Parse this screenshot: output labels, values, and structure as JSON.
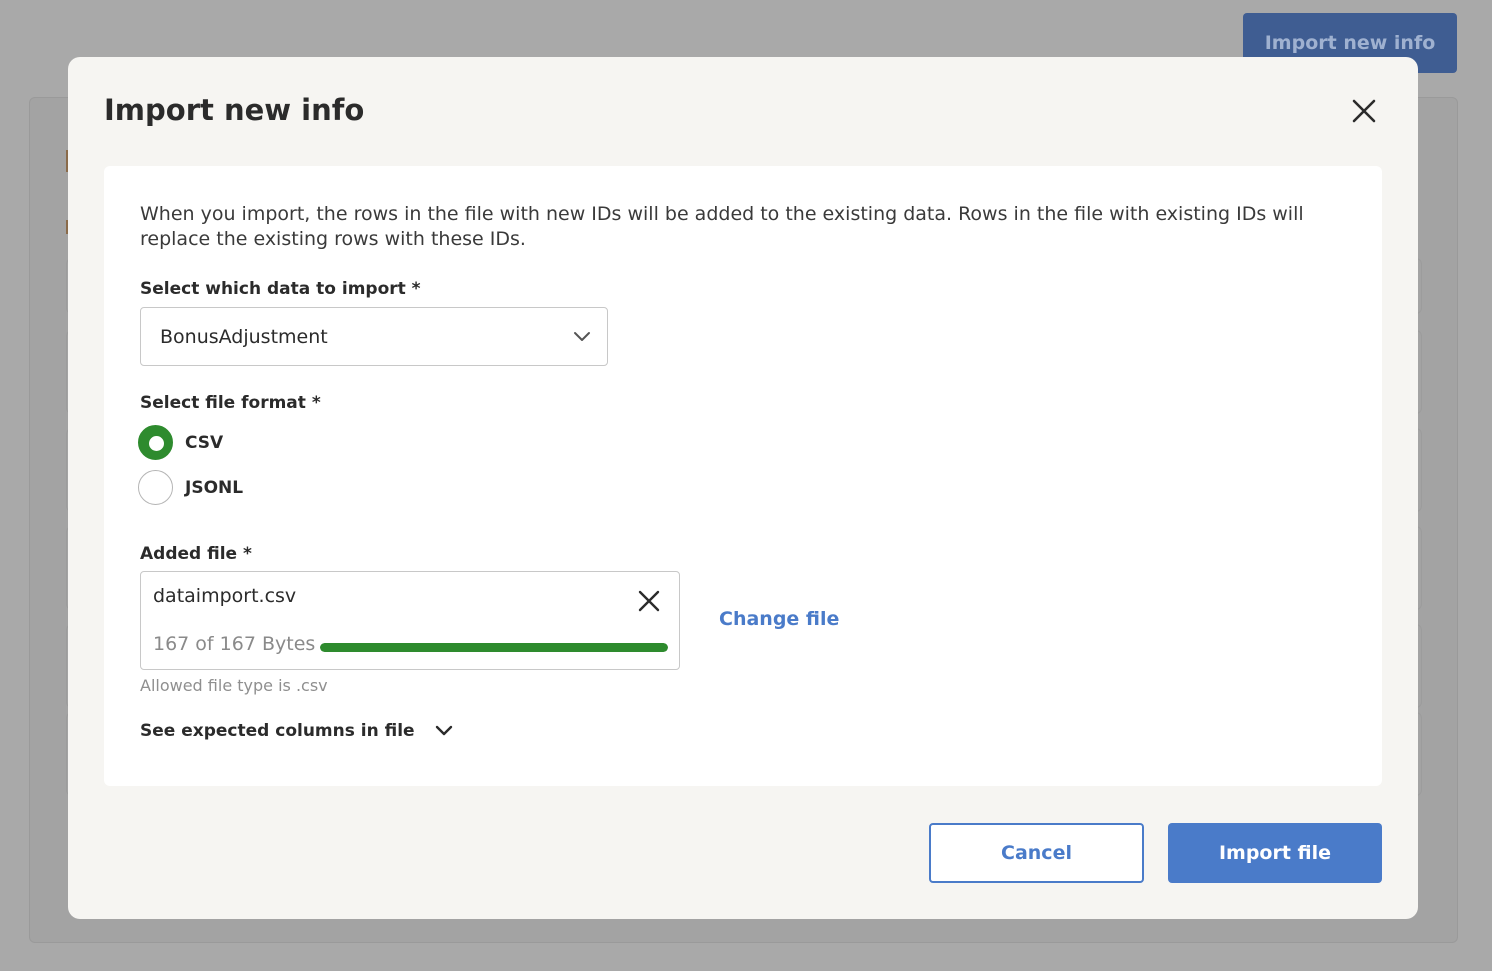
{
  "background": {
    "import_button_label": "Import new info"
  },
  "modal": {
    "title": "Import new info",
    "close_icon": "close-icon",
    "intro_text": "When you import, the rows in the file with new IDs will be added to the existing data. Rows in the file with existing IDs will replace the existing rows with these IDs.",
    "data_select": {
      "label": "Select which data to import *",
      "value": "BonusAdjustment"
    },
    "file_format": {
      "label": "Select file format *",
      "options": [
        {
          "label": "CSV",
          "checked": true
        },
        {
          "label": "JSONL",
          "checked": false
        }
      ]
    },
    "added_file": {
      "label": "Added file *",
      "filename": "dataimport.csv",
      "progress_text": "167 of 167 Bytes",
      "progress_fraction": 1.0,
      "change_label": "Change file",
      "hint": "Allowed file type is .csv"
    },
    "expected_columns_label": "See expected columns in file",
    "buttons": {
      "cancel": "Cancel",
      "import": "Import file"
    }
  },
  "colors": {
    "primary": "#4a7bc9",
    "success": "#2e8b2e",
    "overlay": "#a9a9a9"
  }
}
